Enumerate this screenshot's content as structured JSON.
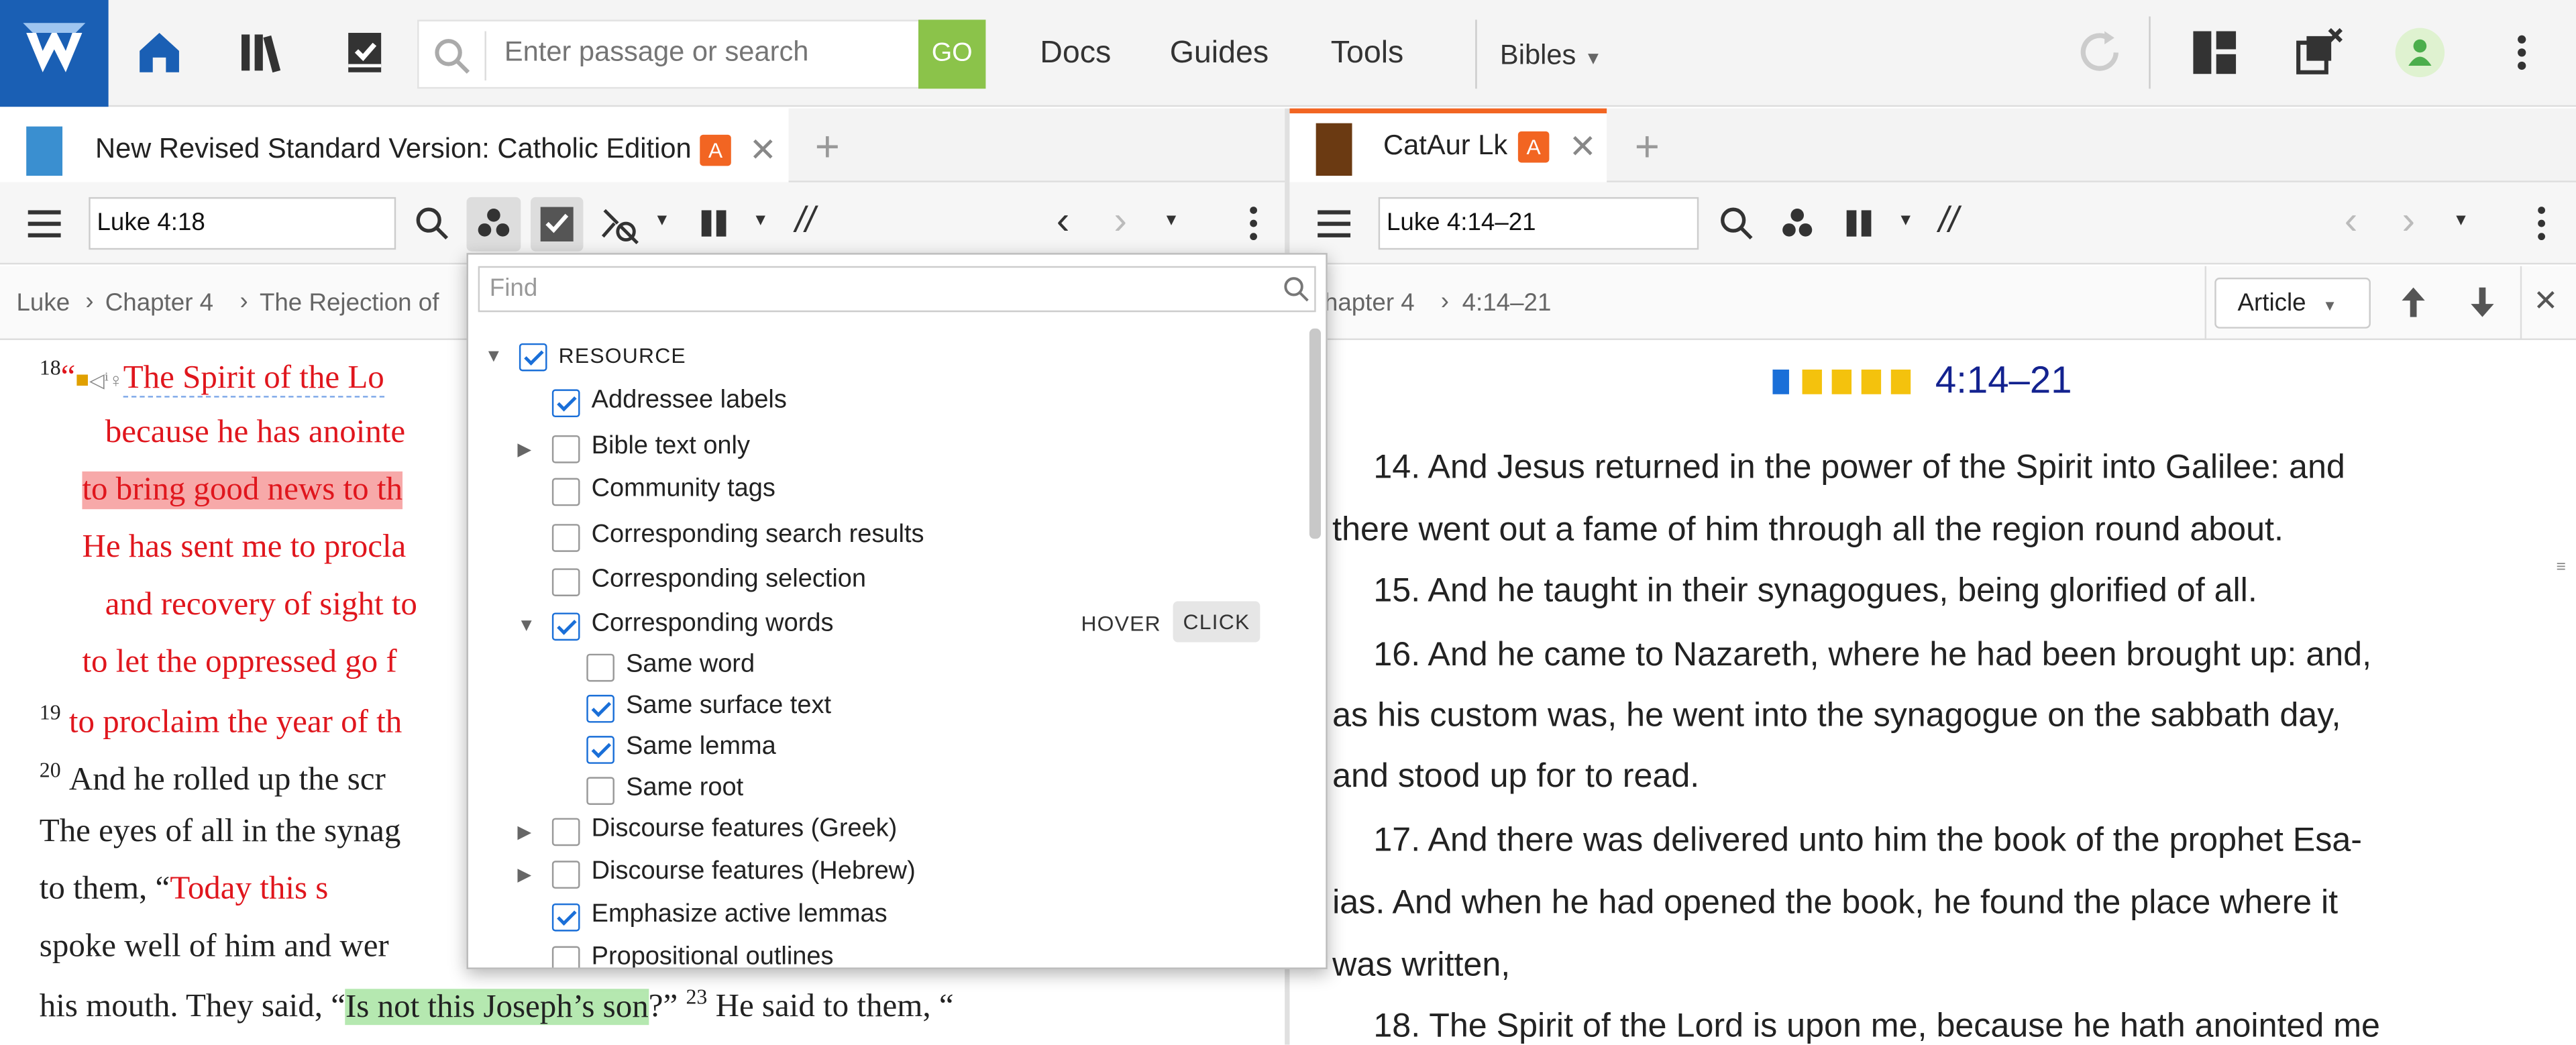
{
  "topbar": {
    "search_placeholder": "Enter passage or search",
    "go_label": "GO",
    "menu": [
      "Docs",
      "Guides",
      "Tools"
    ],
    "bibles_label": "Bibles"
  },
  "left_pane": {
    "tab_title": "New Revised Standard Version: Catholic Edition",
    "tab_badge": "A",
    "reference": "Luke 4:18",
    "breadcrumb": [
      "Luke",
      "Chapter 4",
      "The Rejection of"
    ],
    "text_lines": [
      {
        "verse": "18",
        "pre": "“",
        "text": "The Spirit of the Lo"
      },
      {
        "text": "because he has anointe"
      },
      {
        "text": "to bring good news to th"
      },
      {
        "text": "He has sent me to procla"
      },
      {
        "text": "and recovery of sight to"
      },
      {
        "text": "to let the oppressed go f"
      },
      {
        "verse": "19",
        "text": "to proclaim the year of th"
      },
      {
        "verse": "20",
        "text": "And he rolled up the scr"
      },
      {
        "text": "The eyes of all in the synag"
      },
      {
        "text": "to them, “",
        "red": "Today this s"
      },
      {
        "text": "spoke well of him and wer"
      },
      {
        "text": "his mouth. They said, “",
        "green": "Is not this Joseph’s son",
        "post": "?”",
        "verse2": "23",
        "post2": "He said to them, “"
      }
    ]
  },
  "popup": {
    "find_placeholder": "Find",
    "items": [
      {
        "label": "RESOURCE",
        "checked": true,
        "expander": "open",
        "level": 0
      },
      {
        "label": "Addressee labels",
        "checked": true,
        "level": 1
      },
      {
        "label": "Bible text only",
        "checked": false,
        "expander": "closed",
        "level": 1
      },
      {
        "label": "Community tags",
        "checked": false,
        "level": 1
      },
      {
        "label": "Corresponding search results",
        "checked": false,
        "level": 1
      },
      {
        "label": "Corresponding selection",
        "checked": false,
        "level": 1
      },
      {
        "label": "Corresponding words",
        "checked": true,
        "expander": "open",
        "level": 1
      },
      {
        "label": "Same word",
        "checked": false,
        "level": 2
      },
      {
        "label": "Same surface text",
        "checked": true,
        "level": 2
      },
      {
        "label": "Same lemma",
        "checked": true,
        "level": 2
      },
      {
        "label": "Same root",
        "checked": false,
        "level": 2
      },
      {
        "label": "Discourse features (Greek)",
        "checked": false,
        "expander": "closed",
        "level": 1
      },
      {
        "label": "Discourse features (Hebrew)",
        "checked": false,
        "expander": "closed",
        "level": 1
      },
      {
        "label": "Emphasize active lemmas",
        "checked": true,
        "level": 1
      },
      {
        "label": "Propositional outlines",
        "checked": false,
        "level": 1
      }
    ],
    "hover_label": "HOVER",
    "click_label": "CLICK"
  },
  "right_pane": {
    "tab_title": "CatAur Lk",
    "tab_badge": "A",
    "reference": "Luke 4:14–21",
    "breadcrumb": [
      "hapter 4",
      "4:14–21"
    ],
    "article_label": "Article",
    "heading": "4:14–21",
    "lines": [
      "14. And Jesus returned in the power of the Spirit into Galilee: and",
      "there went out a fame of him through all the region round about.",
      "15. And he taught in their synagogues, being glorified of all.",
      "16. And he came to Nazareth, where he had been brought up: and,",
      "as his custom was, he went into the synagogue on the sabbath day,",
      "and stood up for to read.",
      "17. And there was delivered unto him the book of the prophet Esa-",
      "ias. And when he had opened the book, he found the place where it",
      "was written,",
      "18. The Spirit of the Lord is upon me, because he hath anointed me"
    ]
  },
  "colors": {
    "brand": "#1a5fb4",
    "go": "#8bc34a",
    "badge": "#f26522",
    "words_of_christ": "#e0161d",
    "accent_tab": "#f26522"
  }
}
